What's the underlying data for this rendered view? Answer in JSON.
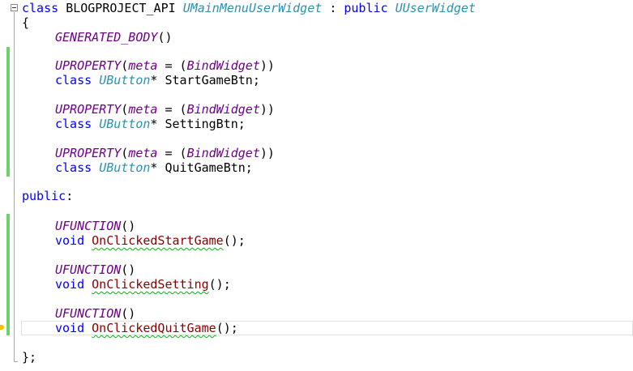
{
  "code": {
    "class_decl": {
      "keyword": "class",
      "api_macro": "BLOGPROJECT_API",
      "class_name": "UMainMenuUserWidget",
      "separator": ":",
      "access": "public",
      "base_class": "UUserWidget"
    },
    "open_brace": "{",
    "generated_body": "GENERATED_BODY",
    "generated_body_parens": "()",
    "properties": [
      {
        "macro": "UPROPERTY",
        "open_paren": "(",
        "meta_key": "meta",
        "equals": "=",
        "inner_open": "(",
        "specifier": "BindWidget",
        "close_parens": "))",
        "keyword": "class",
        "type": "UButton",
        "pointer": "*",
        "name": "StartGameBtn;"
      },
      {
        "macro": "UPROPERTY",
        "open_paren": "(",
        "meta_key": "meta",
        "equals": "=",
        "inner_open": "(",
        "specifier": "BindWidget",
        "close_parens": "))",
        "keyword": "class",
        "type": "UButton",
        "pointer": "*",
        "name": "SettingBtn;"
      },
      {
        "macro": "UPROPERTY",
        "open_paren": "(",
        "meta_key": "meta",
        "equals": "=",
        "inner_open": "(",
        "specifier": "BindWidget",
        "close_parens": "))",
        "keyword": "class",
        "type": "UButton",
        "pointer": "*",
        "name": "QuitGameBtn;"
      }
    ],
    "public_label": "public",
    "public_colon": ":",
    "functions": [
      {
        "macro": "UFUNCTION",
        "macro_parens": "()",
        "return_type": "void",
        "name": "OnClickedStartGame",
        "suffix": "();"
      },
      {
        "macro": "UFUNCTION",
        "macro_parens": "()",
        "return_type": "void",
        "name": "OnClickedSetting",
        "suffix": "();"
      },
      {
        "macro": "UFUNCTION",
        "macro_parens": "()",
        "return_type": "void",
        "name": "OnClickedQuitGame",
        "suffix": "();"
      }
    ],
    "close_brace": "};"
  },
  "colors": {
    "keyword": "#0000ff",
    "type": "#2b91af",
    "macro": "#6f008a",
    "function_name": "#880000",
    "squiggle": "#1aa81a",
    "change_bar": "#6cd26c",
    "warning": "#f2c200"
  },
  "icons": {
    "collapse": "collapse-minus-icon",
    "warning": "warning-marker-icon"
  }
}
